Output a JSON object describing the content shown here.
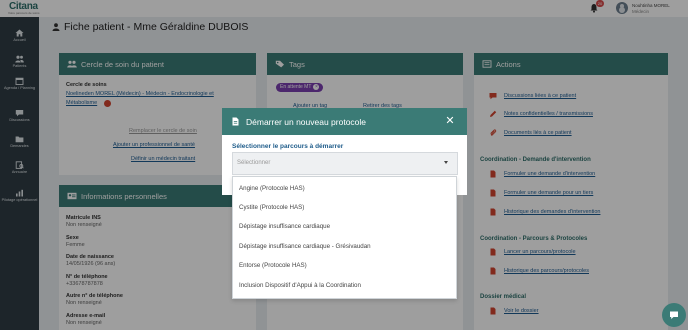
{
  "app": {
    "logo": "Citana",
    "logo_sub": "Votre parcours de soins"
  },
  "topbar": {
    "notification_count": "20",
    "user_name": "Nouhtinha MOREL",
    "user_role": "Médecin"
  },
  "sidebar": {
    "items": [
      {
        "label": "Accueil",
        "icon": "home-icon"
      },
      {
        "label": "Patients",
        "icon": "patients-icon"
      },
      {
        "label": "Agenda / Planning",
        "icon": "calendar-icon"
      },
      {
        "label": "Discussions",
        "icon": "chat-icon"
      },
      {
        "label": "Demandes",
        "icon": "folder-icon"
      },
      {
        "label": "Annuaire",
        "icon": "directory-icon"
      },
      {
        "label": "Pilotage opérationnel",
        "icon": "chart-icon"
      }
    ]
  },
  "page": {
    "title": "Fiche patient - Mme Géraldine DUBOIS"
  },
  "cercle": {
    "title": "Cercle de soin du patient",
    "heading": "Cercle de soins",
    "member_line1": "Noelineden MOREL (Médecin) - Médecin - Endocrinologie et",
    "member_line2": "Métabolisme",
    "action_1": "Remplacer le cercle de soin",
    "action_2": "Ajouter un professionnel de santé",
    "action_3": "Définir un médecin traitant"
  },
  "infos": {
    "title": "Informations personnelles",
    "fields": [
      {
        "label": "Matricule INS",
        "value": "Non renseigné"
      },
      {
        "label": "Sexe",
        "value": "Femme"
      },
      {
        "label": "Date de naissance",
        "value": "14/05/1926 (96 ans)"
      },
      {
        "label": "N° de téléphone",
        "value": "+33678787878"
      },
      {
        "label": "Autre n° de téléphone",
        "value": "Non renseigné"
      },
      {
        "label": "Adresse e-mail",
        "value": "Non renseigné"
      }
    ]
  },
  "tags": {
    "title": "Tags",
    "tag_label": "En attente MT",
    "link_1": "Ajouter un tag",
    "link_2": "Retirer des tags"
  },
  "actions": {
    "title": "Actions",
    "links": [
      "Discussions liées à ce patient",
      "Notes confidentielles / transmissions",
      "Documents liés à ce patient"
    ],
    "section_demande": "Coordination - Demande d'intervention",
    "demande_links": [
      "Formuler une demande d'intervention",
      "Formuler une demande pour un tiers",
      "Historique des demandes d'intervention"
    ],
    "section_parcours": "Coordination - Parcours & Protocoles",
    "parcours_links": [
      "Lancer un parcours/protocole",
      "Historique des parcours/protocoles"
    ],
    "section_dossier": "Dossier médical",
    "dossier_links": [
      "Voir le dossier"
    ]
  },
  "modal": {
    "title": "Démarrer un nouveau protocole",
    "label": "Sélectionner le parcours à démarrer",
    "select_placeholder": "Sélectionner",
    "options": [
      "Angine (Protocole HAS)",
      "Cystite (Protocole HAS)",
      "Dépistage insuffisance cardiaque",
      "Dépistage insuffisance cardiaque - Grésivaudan",
      "Entorse (Protocole HAS)",
      "Inclusion Dispositif d'Appui à la Coordination"
    ]
  },
  "colors": {
    "primary": "#3b7b76",
    "sidebar": "#2f3c44",
    "tag": "#7b3fb0",
    "link": "#1e5c92",
    "alert_icon": "#d2452f"
  }
}
